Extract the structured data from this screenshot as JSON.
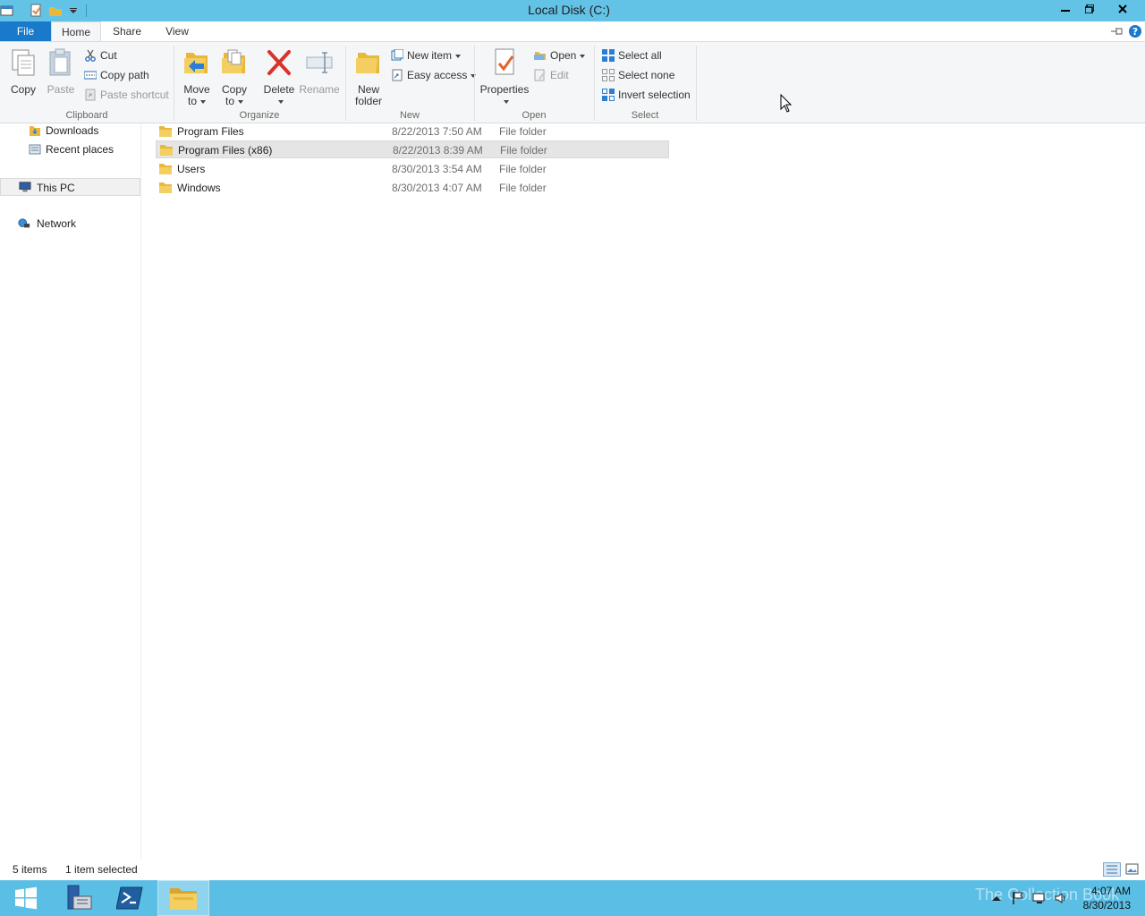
{
  "window": {
    "title": "Local Disk (C:)"
  },
  "tabs": {
    "file": "File",
    "home": "Home",
    "share": "Share",
    "view": "View"
  },
  "ribbon": {
    "clipboard": {
      "label": "Clipboard",
      "copy": "Copy",
      "paste": "Paste",
      "cut": "Cut",
      "copy_path": "Copy path",
      "paste_shortcut": "Paste shortcut"
    },
    "organize": {
      "label": "Organize",
      "move_to_1": "Move",
      "move_to_2": "to",
      "copy_to_1": "Copy",
      "copy_to_2": "to",
      "delete": "Delete",
      "rename": "Rename"
    },
    "new": {
      "label": "New",
      "new_folder_1": "New",
      "new_folder_2": "folder",
      "new_item": "New item",
      "easy_access": "Easy access"
    },
    "open": {
      "label": "Open",
      "properties": "Properties",
      "open": "Open",
      "edit": "Edit"
    },
    "select": {
      "label": "Select",
      "select_all": "Select all",
      "select_none": "Select none",
      "invert_selection": "Invert selection"
    }
  },
  "nav": {
    "downloads": "Downloads",
    "recent_places": "Recent places",
    "this_pc": "This PC",
    "network": "Network"
  },
  "files": [
    {
      "name": "Program Files",
      "date": "8/22/2013 7:50 AM",
      "type": "File folder",
      "selected": false
    },
    {
      "name": "Program Files (x86)",
      "date": "8/22/2013 8:39 AM",
      "type": "File folder",
      "selected": true
    },
    {
      "name": "Users",
      "date": "8/30/2013 3:54 AM",
      "type": "File folder",
      "selected": false
    },
    {
      "name": "Windows",
      "date": "8/30/2013 4:07 AM",
      "type": "File folder",
      "selected": false
    }
  ],
  "status": {
    "items": "5 items",
    "selected": "1 item selected"
  },
  "taskbar": {
    "time": "4:07 AM",
    "date": "8/30/2013",
    "watermark": "The Collection Book"
  },
  "colors": {
    "titlebar": "#63c3e7",
    "file_tab": "#1979ca",
    "taskbar": "#5bbee5",
    "folder": "#e8b83c"
  }
}
